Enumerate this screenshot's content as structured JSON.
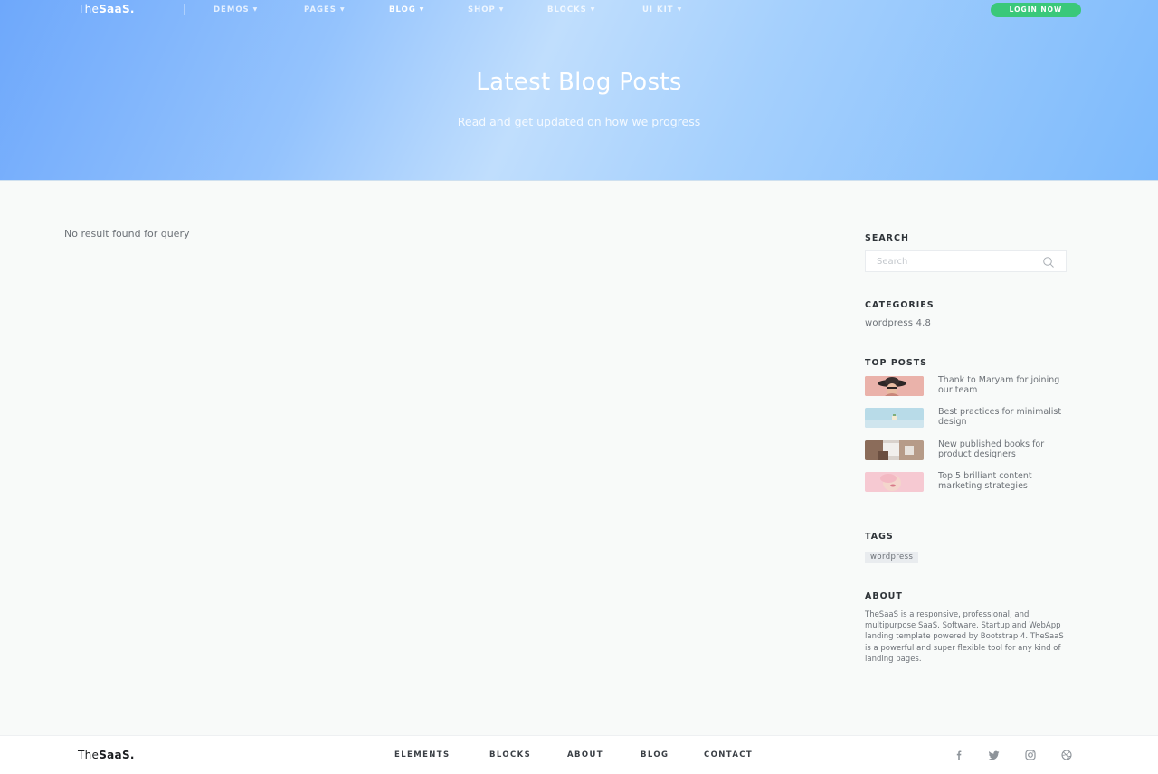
{
  "header": {
    "logo_the": "The",
    "logo_saas": "SaaS.",
    "nav": [
      {
        "label": "DEMOS"
      },
      {
        "label": "PAGES"
      },
      {
        "label": "BLOG"
      },
      {
        "label": "SHOP"
      },
      {
        "label": "BLOCKS"
      },
      {
        "label": "UI KIT"
      }
    ],
    "active_nav": "BLOG",
    "login_label": "LOGIN NOW"
  },
  "hero": {
    "title": "Latest Blog Posts",
    "subtitle": "Read and get updated on how we progress"
  },
  "main": {
    "no_result": "No result found for query"
  },
  "sidebar": {
    "search": {
      "title": "SEARCH",
      "placeholder": "Search",
      "value": ""
    },
    "categories": {
      "title": "CATEGORIES",
      "items": [
        "wordpress 4.8"
      ]
    },
    "top_posts": {
      "title": "TOP POSTS",
      "items": [
        {
          "title": "Thank to Maryam for joining our team",
          "thumb": "woman-hat-photo"
        },
        {
          "title": "Best practices for minimalist design",
          "thumb": "minimal-desk-photo"
        },
        {
          "title": "New published books for product designers",
          "thumb": "books-photo"
        },
        {
          "title": "Top 5 brilliant content marketing strategies",
          "thumb": "pink-portrait-photo"
        }
      ]
    },
    "tags": {
      "title": "TAGS",
      "items": [
        "wordpress"
      ]
    },
    "about": {
      "title": "ABOUT",
      "text": "TheSaaS is a responsive, professional, and multipurpose SaaS, Software, Startup and WebApp landing template powered by Bootstrap 4. TheSaaS is a powerful and super flexible tool for any kind of landing pages."
    }
  },
  "footer": {
    "logo_the": "The",
    "logo_saas": "SaaS.",
    "links": [
      {
        "label": "ELEMENTS"
      },
      {
        "label": "BLOCKS"
      },
      {
        "label": "ABOUT"
      },
      {
        "label": "BLOG"
      },
      {
        "label": "CONTACT"
      }
    ],
    "social": [
      "facebook-icon",
      "twitter-icon",
      "instagram-icon",
      "dribbble-icon"
    ]
  },
  "colors": {
    "accent_green": "#3ac87a",
    "hero_gradient_start": "#6ea8fb",
    "hero_gradient_end": "#7dbafc"
  }
}
